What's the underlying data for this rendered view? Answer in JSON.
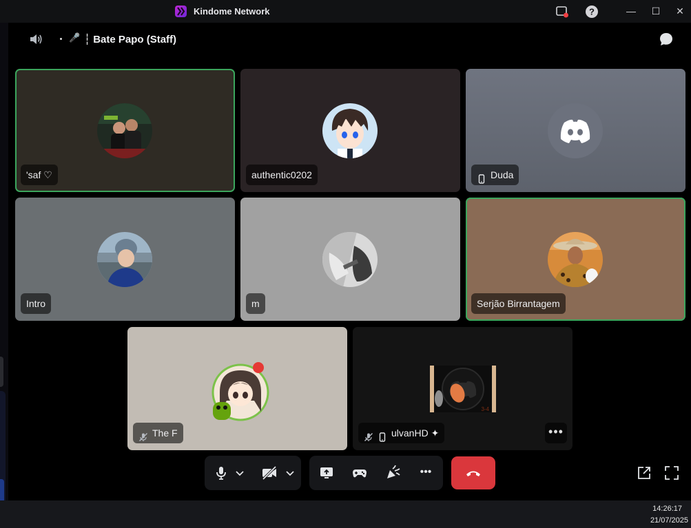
{
  "window": {
    "title": "Kindome Network",
    "controls": {
      "minimize": "—",
      "maximize": "☐",
      "close": "✕"
    }
  },
  "channel": {
    "dot": "•",
    "mic": "🎤",
    "name": "┆ Bate Papo (Staff)"
  },
  "participants": [
    {
      "name": "'saf ♡",
      "speaking": true,
      "muted": false,
      "mobile": false,
      "avatar": "photo-group-icon"
    },
    {
      "name": "authentic0202",
      "speaking": false,
      "muted": false,
      "mobile": false,
      "avatar": "anime-boy-icon"
    },
    {
      "name": "Duda",
      "speaking": false,
      "muted": false,
      "mobile": true,
      "avatar": "discord-logo-icon"
    },
    {
      "name": "Intro",
      "speaking": false,
      "muted": false,
      "mobile": false,
      "avatar": "photo-person-icon"
    },
    {
      "name": "m",
      "speaking": false,
      "muted": false,
      "mobile": false,
      "avatar": "photo-bw-icon"
    },
    {
      "name": "Serjão Birrantagem",
      "speaking": true,
      "muted": false,
      "mobile": false,
      "avatar": "photo-cowboy-icon"
    },
    {
      "name": "The F",
      "speaking": false,
      "muted": true,
      "mobile": false,
      "avatar": "anime-girl-icon"
    },
    {
      "name": "ulvanHD ✦",
      "speaking": false,
      "muted": true,
      "mobile": true,
      "avatar": "discord-logo-icon",
      "more": "•••"
    }
  ],
  "controls": {
    "mic": "microphone-icon",
    "camera": "camera-off-icon",
    "screenshare": "screen-share-icon",
    "activities": "gamepad-icon",
    "soundboard": "soundboard-icon",
    "more": "•••",
    "hangup": "hangup-icon"
  },
  "taskbar": {
    "time": "14:26:17",
    "date": "21/07/2025"
  },
  "colors": {
    "speaking_border": "#3ba55c",
    "hangup": "#da373c",
    "background": "#000000"
  }
}
